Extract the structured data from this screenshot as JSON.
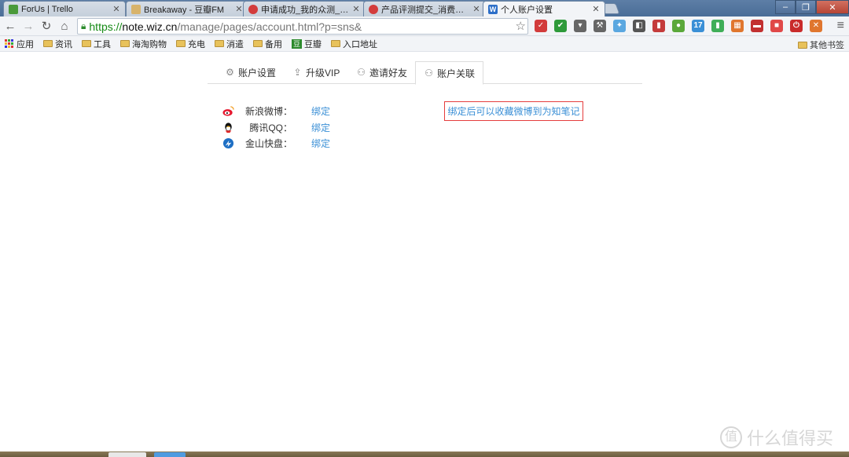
{
  "browser": {
    "tabs": [
      {
        "title": "ForUs | Trello",
        "favicon_color": "#4a9a3a",
        "active": false
      },
      {
        "title": "Breakaway - 豆瓣FM",
        "favicon_color": "#d8b36a",
        "active": false
      },
      {
        "title": "申请成功_我的众测_什么值",
        "favicon_color": "#d33c3c",
        "active": false
      },
      {
        "title": "产品评测提交_消费众测_值",
        "favicon_color": "#d33c3c",
        "active": false
      },
      {
        "title": "个人账户设置",
        "favicon_color": "#2d6fc8",
        "active": true
      }
    ],
    "address": {
      "protocol": "https://",
      "host": "note.wiz.cn",
      "path": "/manage/pages/account.html?p=sns&"
    },
    "extensions": [
      {
        "name": "pocket-red-icon",
        "color": "#d23b3b",
        "glyph": "✓"
      },
      {
        "name": "check-green-icon",
        "color": "#2e9a3a",
        "glyph": "✔"
      },
      {
        "name": "pocket-gray-icon",
        "color": "#666666",
        "glyph": "▾"
      },
      {
        "name": "tool-icon",
        "color": "#666666",
        "glyph": "⚒"
      },
      {
        "name": "bird-icon",
        "color": "#5aa7e0",
        "glyph": "✦"
      },
      {
        "name": "clip-icon",
        "color": "#555555",
        "glyph": "◧"
      },
      {
        "name": "book-icon",
        "color": "#c43b3b",
        "glyph": "▮"
      },
      {
        "name": "evernote-icon",
        "color": "#5aa83a",
        "glyph": "●"
      },
      {
        "name": "weibo-ext-icon",
        "color": "#3a8fd6",
        "glyph": "17"
      },
      {
        "name": "green-bar-icon",
        "color": "#3fae58",
        "glyph": "▮"
      },
      {
        "name": "orange-grid-icon",
        "color": "#e0762e",
        "glyph": "▦"
      },
      {
        "name": "car-icon",
        "color": "#c23030",
        "glyph": "▬"
      },
      {
        "name": "red-square-icon",
        "color": "#e04848",
        "glyph": "■"
      },
      {
        "name": "power-icon",
        "color": "#c92b2b",
        "glyph": "⏻"
      },
      {
        "name": "close-ext-icon",
        "color": "#e0762e",
        "glyph": "✕"
      }
    ],
    "bookmarks": {
      "apps_label": "应用",
      "folders": [
        "资讯",
        "工具",
        "海淘购物",
        "充电",
        "消遣",
        "备用"
      ],
      "douban_label": "豆瓣",
      "folder_last": "入口地址",
      "other_label": "其他书签"
    }
  },
  "page": {
    "tabs": [
      {
        "label": "账户设置",
        "icon": "gear-icon",
        "glyph": "⚙",
        "active": false
      },
      {
        "label": "升级VIP",
        "icon": "upgrade-icon",
        "glyph": "⇪",
        "active": false
      },
      {
        "label": "邀请好友",
        "icon": "invite-user-icon",
        "glyph": "⚇",
        "active": false
      },
      {
        "label": "账户关联",
        "icon": "user-link-icon",
        "glyph": "⚇",
        "active": true
      }
    ],
    "sns": [
      {
        "name": "新浪微博：",
        "action": "绑定",
        "icon": "weibo-icon"
      },
      {
        "name": "腾讯QQ：",
        "action": "绑定",
        "icon": "qq-icon"
      },
      {
        "name": "金山快盘：",
        "action": "绑定",
        "icon": "kuaipan-icon"
      }
    ],
    "tip": "绑定后可以收藏微博到为知笔记",
    "watermark": "什么值得买",
    "colors": {
      "link": "#3a8fd6",
      "tip_border": "#e53d3d"
    }
  }
}
